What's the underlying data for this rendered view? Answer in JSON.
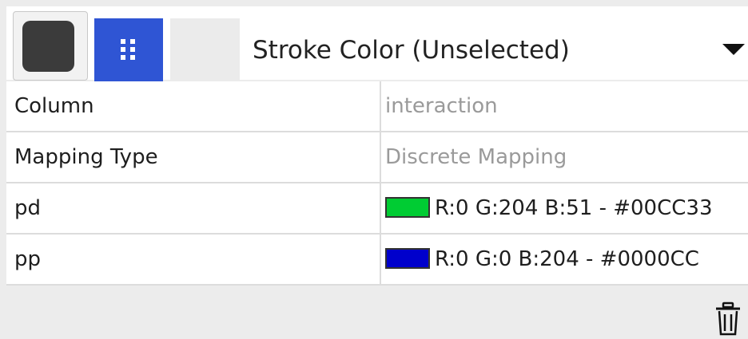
{
  "property": {
    "title": "Stroke Color (Unselected)",
    "default_color": "#3b3b3b",
    "mapping_button_color": "#2f55d4"
  },
  "table": {
    "rows": [
      {
        "key": "Column",
        "value": "interaction"
      },
      {
        "key": "Mapping Type",
        "value": "Discrete Mapping"
      },
      {
        "key": "pd",
        "value": "R:0 G:204 B:51 - #00CC33",
        "color": "#00CC33"
      },
      {
        "key": "pp",
        "value": "R:0 G:0 B:204 - #0000CC",
        "color": "#0000CC"
      }
    ]
  },
  "icons": {
    "mapping": "grip-dots-icon",
    "dropdown": "triangle-down-icon",
    "delete": "trash-icon"
  }
}
